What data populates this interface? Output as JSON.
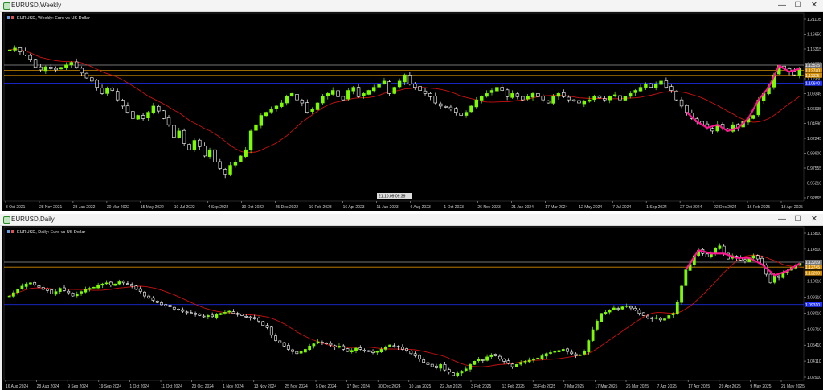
{
  "weekly": {
    "window_title": "EURUSD,Weekly",
    "chart_label": "EURUSD, Weekly:  Euro vs US Dollar",
    "cursor_date": "21.10.09",
    "cursor_time": "09:39",
    "price_ticks": [
      "1.21105",
      "1.16650",
      "1.16315",
      "1.13575",
      "1.11930",
      "1.09345",
      "1.06935",
      "1.04590",
      "1.02245",
      "0.99900",
      "0.97555",
      "0.95210",
      "0.92865"
    ],
    "price_tags": [
      "1.13575",
      "1.12740",
      "1.11925",
      "1.10640"
    ],
    "date_ticks": [
      "3 Oct 2021",
      "28 Nov 2021",
      "23 Jan 2022",
      "20 Mar 2022",
      "15 May 2022",
      "10 Jul 2022",
      "4 Sep 2022",
      "30 Oct 2022",
      "25 Dec 2022",
      "19 Feb 2023",
      "16 Apr 2023",
      "11 Jun 2023",
      "6 Aug 2023",
      "1 Oct 2023",
      "26 Nov 2023",
      "21 Jan 2024",
      "17 Mar 2024",
      "12 May 2024",
      "7 Jul 2024",
      "1 Sep 2024",
      "27 Oct 2024",
      "22 Dec 2024",
      "16 Feb 2025",
      "13 Apr 2025"
    ]
  },
  "daily": {
    "window_title": "EURUSD,Daily",
    "chart_label": "EURUSD, Daily:  Euro vs US Dollar",
    "price_ticks": [
      "1.15810",
      "1.14510",
      "1.13120",
      "1.10610",
      "1.09310",
      "1.08010",
      "1.06710",
      "1.05410",
      "1.04110",
      "1.02910"
    ],
    "price_tags": [
      "1.13209",
      "1.12745",
      "1.12200",
      "1.09310"
    ],
    "date_ticks": [
      "16 Aug 2024",
      "28 Aug 2024",
      "9 Sep 2024",
      "19 Sep 2024",
      "1 Oct 2024",
      "11 Oct 2024",
      "23 Oct 2024",
      "1 Nov 2024",
      "13 Nov 2024",
      "25 Nov 2024",
      "5 Dec 2024",
      "17 Dec 2024",
      "30 Dec 2024",
      "10 Jan 2025",
      "22 Jan 2025",
      "3 Feb 2025",
      "13 Feb 2025",
      "25 Feb 2025",
      "7 Mar 2025",
      "17 Mar 2025",
      "26 Mar 2025",
      "7 Apr 2025",
      "17 Apr 2025",
      "29 Apr 2025",
      "9 May 2025",
      "21 May 2025"
    ]
  },
  "controls": {
    "minimize": "—",
    "maximize": "☐",
    "close": "✕"
  },
  "colors": {
    "bull": "#7CFC00",
    "bear": "#ffffff",
    "ma": "#cc1111",
    "pattern": "#ff1493",
    "level_blue": "#2233ff",
    "level_orange": "#d08a00",
    "level_gray": "#9a9a9a"
  },
  "chart_data": [
    {
      "type": "candlestick",
      "title": "EURUSD, Weekly:  Euro vs US Dollar",
      "x_ticks": [
        "3 Oct 2021",
        "28 Nov 2021",
        "23 Jan 2022",
        "20 Mar 2022",
        "15 May 2022",
        "10 Jul 2022",
        "4 Sep 2022",
        "30 Oct 2022",
        "25 Dec 2022",
        "19 Feb 2023",
        "16 Apr 2023",
        "11 Jun 2023",
        "6 Aug 2023",
        "1 Oct 2023",
        "26 Nov 2023",
        "21 Jan 2024",
        "17 Mar 2024",
        "12 May 2024",
        "7 Jul 2024",
        "1 Sep 2024",
        "27 Oct 2024",
        "22 Dec 2024",
        "16 Feb 2025",
        "13 Apr 2025"
      ],
      "ylim": [
        0.9177,
        1.2169
      ],
      "close_series": [
        1.16,
        1.163,
        1.157,
        1.152,
        1.145,
        1.132,
        1.128,
        1.133,
        1.13,
        1.128,
        1.132,
        1.136,
        1.14,
        1.132,
        1.123,
        1.115,
        1.11,
        1.1,
        1.09,
        1.098,
        1.095,
        1.08,
        1.07,
        1.06,
        1.05,
        1.055,
        1.05,
        1.06,
        1.07,
        1.062,
        1.05,
        1.04,
        1.02,
        1.03,
        1.01,
        1.0,
        1.015,
        1.005,
        0.99,
        1.0,
        0.98,
        0.97,
        0.96,
        0.975,
        0.98,
        0.99,
        1.0,
        1.03,
        1.04,
        1.055,
        1.06,
        1.065,
        1.07,
        1.075,
        1.085,
        1.09,
        1.08,
        1.075,
        1.06,
        1.065,
        1.075,
        1.085,
        1.09,
        1.095,
        1.085,
        1.08,
        1.095,
        1.1,
        1.085,
        1.09,
        1.095,
        1.1,
        1.105,
        1.11,
        1.09,
        1.1,
        1.11,
        1.12,
        1.105,
        1.1,
        1.095,
        1.09,
        1.085,
        1.075,
        1.07,
        1.068,
        1.065,
        1.06,
        1.055,
        1.06,
        1.07,
        1.08,
        1.085,
        1.09,
        1.095,
        1.1,
        1.095,
        1.085,
        1.09,
        1.085,
        1.08,
        1.085,
        1.09,
        1.085,
        1.08,
        1.075,
        1.085,
        1.09,
        1.085,
        1.08,
        1.078,
        1.075,
        1.078,
        1.08,
        1.085,
        1.083,
        1.08,
        1.085,
        1.088,
        1.08,
        1.085,
        1.09,
        1.095,
        1.1,
        1.105,
        1.1,
        1.105,
        1.11,
        1.1,
        1.095,
        1.08,
        1.07,
        1.06,
        1.05,
        1.045,
        1.04,
        1.035,
        1.03,
        1.04,
        1.035,
        1.03,
        1.04,
        1.035,
        1.045,
        1.05,
        1.055,
        1.08,
        1.09,
        1.1,
        1.12,
        1.135,
        1.13,
        1.125,
        1.12,
        1.13
      ],
      "moving_average": {
        "start": 1.165,
        "end": 1.07
      },
      "levels": [
        1.1357,
        1.1274,
        1.1192,
        1.1064
      ]
    },
    {
      "type": "candlestick",
      "title": "EURUSD, Daily:  Euro vs US Dollar",
      "x_ticks": [
        "16 Aug 2024",
        "28 Aug 2024",
        "9 Sep 2024",
        "19 Sep 2024",
        "1 Oct 2024",
        "11 Oct 2024",
        "23 Oct 2024",
        "1 Nov 2024",
        "13 Nov 2024",
        "25 Nov 2024",
        "5 Dec 2024",
        "17 Dec 2024",
        "30 Dec 2024",
        "10 Jan 2025",
        "22 Jan 2025",
        "3 Feb 2025",
        "13 Feb 2025",
        "25 Feb 2025",
        "7 Mar 2025",
        "17 Mar 2025",
        "26 Mar 2025",
        "7 Apr 2025",
        "17 Apr 2025",
        "29 Apr 2025",
        "9 May 2025",
        "21 May 2025"
      ],
      "ylim": [
        1.0235,
        1.1631
      ],
      "close_series": [
        1.101,
        1.104,
        1.107,
        1.11,
        1.112,
        1.113,
        1.111,
        1.109,
        1.107,
        1.106,
        1.103,
        1.105,
        1.108,
        1.106,
        1.104,
        1.101,
        1.103,
        1.105,
        1.107,
        1.108,
        1.109,
        1.111,
        1.112,
        1.113,
        1.111,
        1.112,
        1.114,
        1.113,
        1.112,
        1.11,
        1.107,
        1.105,
        1.101,
        1.099,
        1.097,
        1.095,
        1.093,
        1.092,
        1.091,
        1.089,
        1.088,
        1.087,
        1.086,
        1.085,
        1.084,
        1.083,
        1.082,
        1.083,
        1.082,
        1.084,
        1.085,
        1.086,
        1.087,
        1.085,
        1.084,
        1.083,
        1.082,
        1.081,
        1.08,
        1.078,
        1.074,
        1.072,
        1.065,
        1.06,
        1.058,
        1.055,
        1.052,
        1.05,
        1.048,
        1.05,
        1.052,
        1.055,
        1.057,
        1.059,
        1.058,
        1.057,
        1.056,
        1.054,
        1.055,
        1.052,
        1.05,
        1.051,
        1.053,
        1.052,
        1.051,
        1.05,
        1.049,
        1.05,
        1.052,
        1.054,
        1.056,
        1.055,
        1.054,
        1.052,
        1.051,
        1.048,
        1.046,
        1.043,
        1.04,
        1.038,
        1.036,
        1.035,
        1.038,
        1.033,
        1.031,
        1.028,
        1.03,
        1.032,
        1.034,
        1.038,
        1.041,
        1.043,
        1.042,
        1.045,
        1.047,
        1.046,
        1.043,
        1.041,
        1.039,
        1.036,
        1.038,
        1.04,
        1.041,
        1.042,
        1.043,
        1.044,
        1.046,
        1.048,
        1.049,
        1.05,
        1.051,
        1.052,
        1.05,
        1.048,
        1.046,
        1.047,
        1.05,
        1.06,
        1.07,
        1.078,
        1.085,
        1.086,
        1.088,
        1.09,
        1.089,
        1.091,
        1.092,
        1.09,
        1.088,
        1.085,
        1.083,
        1.081,
        1.08,
        1.081,
        1.079,
        1.08,
        1.083,
        1.085,
        1.095,
        1.11,
        1.125,
        1.13,
        1.138,
        1.143,
        1.14,
        1.137,
        1.14,
        1.145,
        1.147,
        1.14,
        1.135,
        1.138,
        1.136,
        1.134,
        1.133,
        1.136,
        1.138,
        1.135,
        1.13,
        1.121,
        1.113,
        1.12,
        1.118,
        1.122,
        1.124,
        1.127,
        1.129,
        1.131
      ],
      "moving_average": {
        "start": 1.105,
        "end": 1.125
      },
      "levels": [
        1.1321,
        1.1275,
        1.122,
        1.0931
      ]
    }
  ]
}
